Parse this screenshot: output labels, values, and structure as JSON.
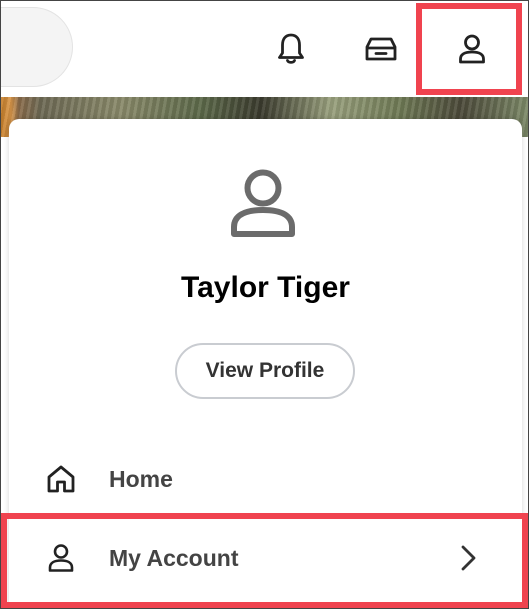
{
  "header": {
    "icons": {
      "notifications": "bell-icon",
      "inbox": "inbox-icon",
      "profile": "user-icon"
    }
  },
  "profile_menu": {
    "user_name": "Taylor Tiger",
    "view_profile_label": "View Profile",
    "items": [
      {
        "label": "Home",
        "icon": "home-icon"
      },
      {
        "label": "My Account",
        "icon": "user-icon",
        "has_submenu": true
      }
    ]
  },
  "colors": {
    "highlight": "#f0434f",
    "icon_gray": "#6b6b6b",
    "text_dark": "#444444"
  }
}
